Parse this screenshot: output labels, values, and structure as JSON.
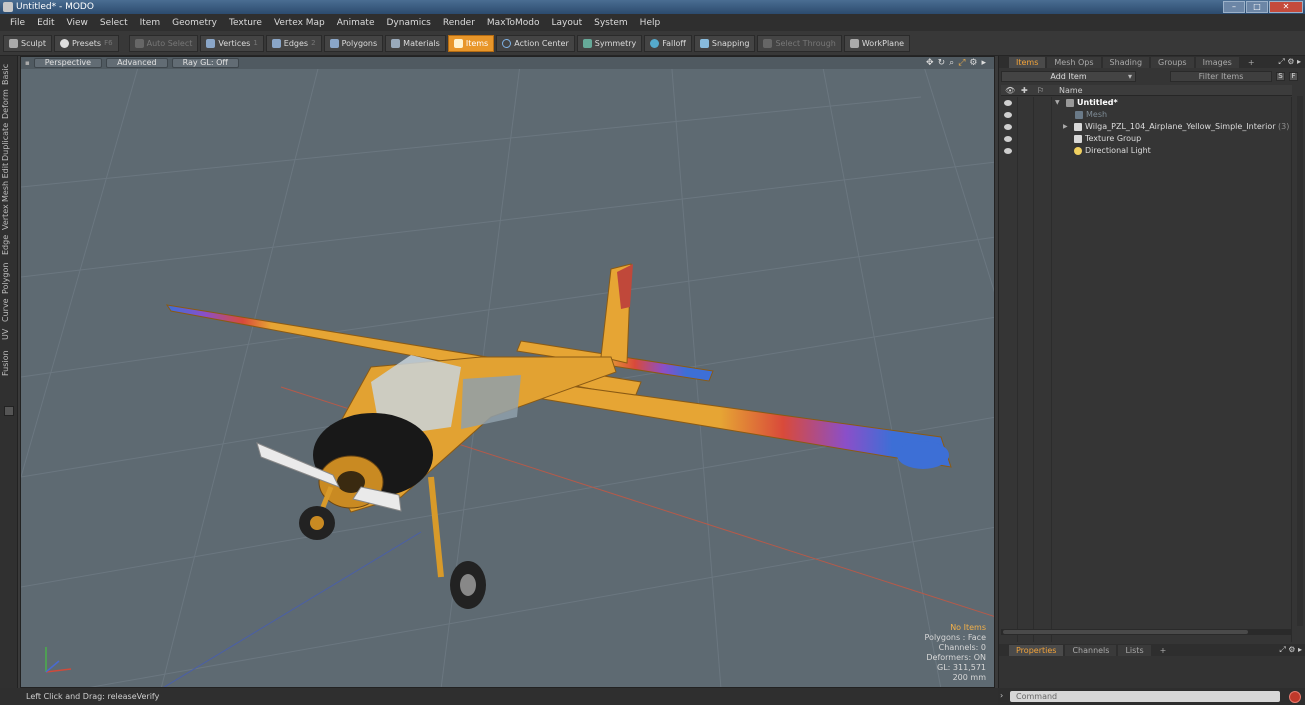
{
  "window": {
    "title": "Untitled* - MODO"
  },
  "menubar": [
    "File",
    "Edit",
    "View",
    "Select",
    "Item",
    "Geometry",
    "Texture",
    "Vertex Map",
    "Animate",
    "Dynamics",
    "Render",
    "MaxToModo",
    "Layout",
    "System",
    "Help"
  ],
  "toolbar": {
    "sculpt": "Sculpt",
    "presets": "Presets",
    "presets_key": "F6",
    "auto_select": "Auto Select",
    "vertices": "Vertices",
    "vertices_key": "1",
    "edges": "Edges",
    "edges_key": "2",
    "polygons": "Polygons",
    "materials": "Materials",
    "items": "Items",
    "action_center": "Action Center",
    "symmetry": "Symmetry",
    "falloff": "Falloff",
    "snapping": "Snapping",
    "select_through": "Select Through",
    "workplane": "WorkPlane"
  },
  "left_tabs": [
    "Basic",
    "Deform",
    "Duplicate",
    "Mesh Edit",
    "Vertex",
    "Edge",
    "Polygon",
    "Curve",
    "UV",
    "Fusion"
  ],
  "viewport": {
    "view": "Perspective",
    "mode": "Advanced",
    "render": "Ray GL: Off",
    "info": {
      "selection": "No Items",
      "polygons": "Polygons : Face",
      "channels": "Channels: 0",
      "deformers": "Deformers: ON",
      "gl": "GL: 311,571",
      "scale": "200 mm"
    }
  },
  "statusbar": {
    "text": "Left Click and Drag:  releaseVerify"
  },
  "items_panel": {
    "tabs": [
      "Items",
      "Mesh Ops",
      "Shading",
      "Groups",
      "Images",
      "+"
    ],
    "add_item": "Add Item",
    "filter": "Filter Items",
    "s_btn": "S",
    "f_btn": "F",
    "column_name": "Name",
    "tree": [
      {
        "label": "Untitled*",
        "count": ""
      },
      {
        "label": "Mesh",
        "count": ""
      },
      {
        "label": "Wilga_PZL_104_Airplane_Yellow_Simple_Interior",
        "count": "(3)"
      },
      {
        "label": "Texture Group",
        "count": ""
      },
      {
        "label": "Directional Light",
        "count": ""
      }
    ]
  },
  "properties_panel": {
    "tabs": [
      "Properties",
      "Channels",
      "Lists",
      "+"
    ]
  },
  "command": {
    "placeholder": "Command"
  },
  "colors": {
    "accent": "#e8962a",
    "viewport_bg": "#5e6a72",
    "plane_body": "#e6a534",
    "wing_blue": "#3d6fd6",
    "wing_red": "#d94a3a"
  }
}
